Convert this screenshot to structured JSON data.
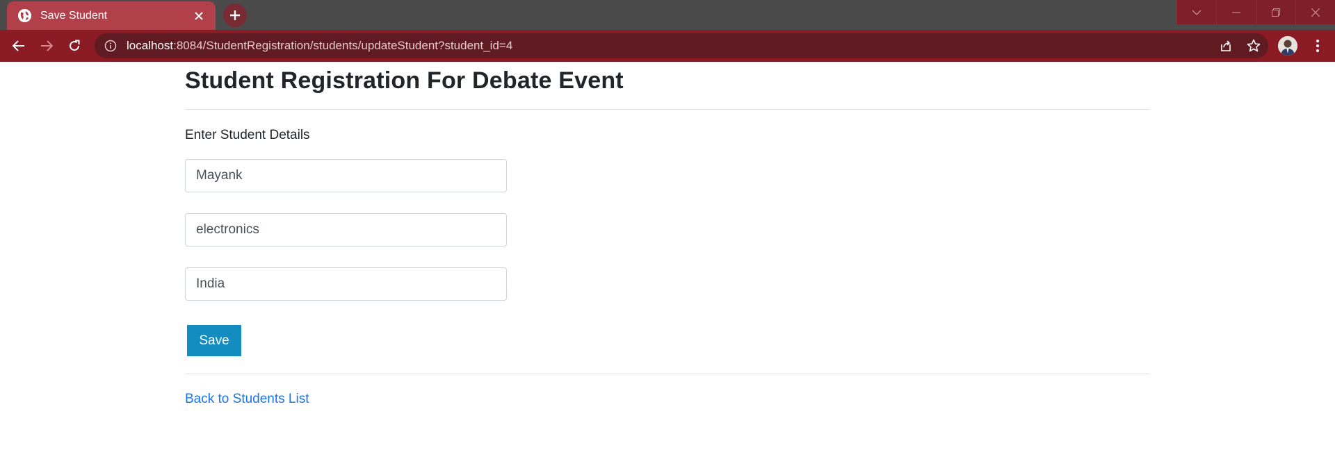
{
  "browser": {
    "tab_title": "Save Student",
    "url_host": "localhost",
    "url_rest": ":8084/StudentRegistration/students/updateStudent?student_id=4"
  },
  "colors": {
    "tab": "#b2404a",
    "toolbar": "#8a1a24",
    "omnibox": "#5f1a22",
    "save_button": "#138cbf",
    "link": "#1a73e8"
  },
  "icons": {
    "favicon": "globe-icon",
    "tab_close": "close-icon",
    "new_tab": "plus-icon",
    "back": "arrow-left-icon",
    "forward": "arrow-right-icon",
    "reload": "reload-icon",
    "site_info": "info-icon",
    "share": "share-icon",
    "bookmark": "star-icon",
    "menu": "kebab-menu-icon"
  },
  "page": {
    "title": "Student Registration For Debate Event",
    "subtitle": "Enter Student Details",
    "form": {
      "name_value": "Mayank",
      "branch_value": "electronics",
      "country_value": "India",
      "save_label": "Save"
    },
    "back_link": "Back to Students List"
  }
}
